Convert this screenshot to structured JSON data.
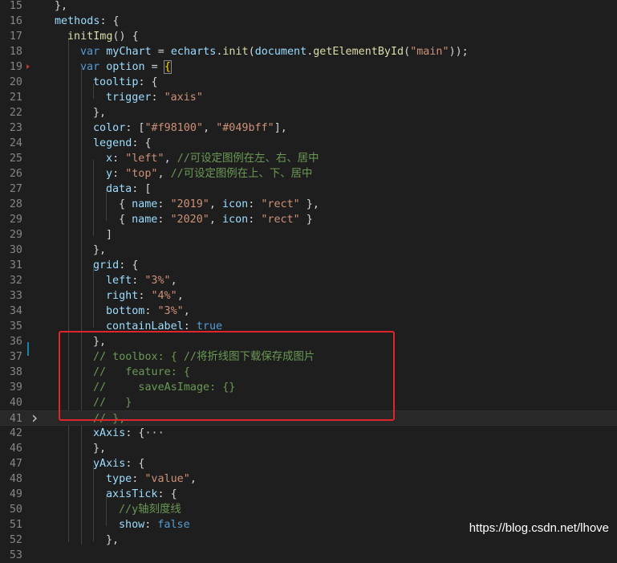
{
  "editor": {
    "lines": [
      {
        "n": "15",
        "tokens": [
          {
            "t": "},",
            "c": "p"
          }
        ]
      },
      {
        "n": "16",
        "tokens": [
          {
            "t": "methods",
            "c": "v"
          },
          {
            "t": ": {",
            "c": "p"
          }
        ]
      },
      {
        "n": "17",
        "tokens": [
          {
            "t": "initImg",
            "c": "f"
          },
          {
            "t": "() {",
            "c": "p"
          }
        ]
      },
      {
        "n": "18",
        "tokens": [
          {
            "t": "var ",
            "c": "k"
          },
          {
            "t": "myChart",
            "c": "v"
          },
          {
            "t": " = ",
            "c": "p"
          },
          {
            "t": "echarts",
            "c": "v"
          },
          {
            "t": ".",
            "c": "p"
          },
          {
            "t": "init",
            "c": "f"
          },
          {
            "t": "(",
            "c": "p"
          },
          {
            "t": "document",
            "c": "v"
          },
          {
            "t": ".",
            "c": "p"
          },
          {
            "t": "getElementById",
            "c": "f"
          },
          {
            "t": "(",
            "c": "p"
          },
          {
            "t": "\"main\"",
            "c": "s"
          },
          {
            "t": "));",
            "c": "p"
          }
        ]
      },
      {
        "n": "19",
        "tokens": [
          {
            "t": "var ",
            "c": "k"
          },
          {
            "t": "option",
            "c": "v"
          },
          {
            "t": " = ",
            "c": "p"
          },
          {
            "t": "{",
            "c": "bh"
          }
        ]
      },
      {
        "n": "20",
        "tokens": [
          {
            "t": "tooltip",
            "c": "v"
          },
          {
            "t": ": {",
            "c": "p"
          }
        ]
      },
      {
        "n": "21",
        "tokens": [
          {
            "t": "trigger",
            "c": "v"
          },
          {
            "t": ": ",
            "c": "p"
          },
          {
            "t": "\"axis\"",
            "c": "s"
          }
        ]
      },
      {
        "n": "22",
        "tokens": [
          {
            "t": "},",
            "c": "p"
          }
        ]
      },
      {
        "n": "23",
        "tokens": [
          {
            "t": "color",
            "c": "v"
          },
          {
            "t": ": [",
            "c": "p"
          },
          {
            "t": "\"#f98100\"",
            "c": "s"
          },
          {
            "t": ", ",
            "c": "p"
          },
          {
            "t": "\"#049bff\"",
            "c": "s"
          },
          {
            "t": "],",
            "c": "p"
          }
        ]
      },
      {
        "n": "24",
        "tokens": [
          {
            "t": "legend",
            "c": "v"
          },
          {
            "t": ": {",
            "c": "p"
          }
        ]
      },
      {
        "n": "25",
        "tokens": [
          {
            "t": "x",
            "c": "v"
          },
          {
            "t": ": ",
            "c": "p"
          },
          {
            "t": "\"left\"",
            "c": "s"
          },
          {
            "t": ", ",
            "c": "p"
          },
          {
            "t": "//可设定图例在左、右、居中",
            "c": "c"
          }
        ]
      },
      {
        "n": "26",
        "tokens": [
          {
            "t": "y",
            "c": "v"
          },
          {
            "t": ": ",
            "c": "p"
          },
          {
            "t": "\"top\"",
            "c": "s"
          },
          {
            "t": ", ",
            "c": "p"
          },
          {
            "t": "//可设定图例在上、下、居中",
            "c": "c"
          }
        ]
      },
      {
        "n": "27",
        "tokens": [
          {
            "t": "data",
            "c": "v"
          },
          {
            "t": ": [",
            "c": "p"
          }
        ]
      },
      {
        "n": "28",
        "tokens": [
          {
            "t": "{ ",
            "c": "p"
          },
          {
            "t": "name",
            "c": "v"
          },
          {
            "t": ": ",
            "c": "p"
          },
          {
            "t": "\"2019\"",
            "c": "s"
          },
          {
            "t": ", ",
            "c": "p"
          },
          {
            "t": "icon",
            "c": "v"
          },
          {
            "t": ": ",
            "c": "p"
          },
          {
            "t": "\"rect\"",
            "c": "s"
          },
          {
            "t": " },",
            "c": "p"
          }
        ]
      },
      {
        "n": "29",
        "tokens": [
          {
            "t": "{ ",
            "c": "p"
          },
          {
            "t": "name",
            "c": "v"
          },
          {
            "t": ": ",
            "c": "p"
          },
          {
            "t": "\"2020\"",
            "c": "s"
          },
          {
            "t": ", ",
            "c": "p"
          },
          {
            "t": "icon",
            "c": "v"
          },
          {
            "t": ": ",
            "c": "p"
          },
          {
            "t": "\"rect\"",
            "c": "s"
          },
          {
            "t": " }",
            "c": "p"
          }
        ]
      },
      {
        "n": "29",
        "tokens": [
          {
            "t": "]",
            "c": "p"
          }
        ]
      },
      {
        "n": "30",
        "tokens": [
          {
            "t": "},",
            "c": "p"
          }
        ]
      },
      {
        "n": "31",
        "tokens": [
          {
            "t": "grid",
            "c": "v"
          },
          {
            "t": ": {",
            "c": "p"
          }
        ]
      },
      {
        "n": "32",
        "tokens": [
          {
            "t": "left",
            "c": "v"
          },
          {
            "t": ": ",
            "c": "p"
          },
          {
            "t": "\"3%\"",
            "c": "s"
          },
          {
            "t": ",",
            "c": "p"
          }
        ]
      },
      {
        "n": "33",
        "tokens": [
          {
            "t": "right",
            "c": "v"
          },
          {
            "t": ": ",
            "c": "p"
          },
          {
            "t": "\"4%\"",
            "c": "s"
          },
          {
            "t": ",",
            "c": "p"
          }
        ]
      },
      {
        "n": "34",
        "tokens": [
          {
            "t": "bottom",
            "c": "v"
          },
          {
            "t": ": ",
            "c": "p"
          },
          {
            "t": "\"3%\"",
            "c": "s"
          },
          {
            "t": ",",
            "c": "p"
          }
        ]
      },
      {
        "n": "35",
        "tokens": [
          {
            "t": "containLabel",
            "c": "v"
          },
          {
            "t": ": ",
            "c": "p"
          },
          {
            "t": "true",
            "c": "k"
          }
        ]
      },
      {
        "n": "36",
        "tokens": [
          {
            "t": "},",
            "c": "p"
          }
        ]
      },
      {
        "n": "37",
        "tokens": [
          {
            "t": "// toolbox: { //将折线图下载保存成图片",
            "c": "c"
          }
        ]
      },
      {
        "n": "38",
        "tokens": [
          {
            "t": "//   feature: {",
            "c": "c"
          }
        ]
      },
      {
        "n": "39",
        "tokens": [
          {
            "t": "//     saveAsImage: {}",
            "c": "c"
          }
        ]
      },
      {
        "n": "40",
        "tokens": [
          {
            "t": "//   }",
            "c": "c"
          }
        ]
      },
      {
        "n": "41",
        "tokens": [
          {
            "t": "// },",
            "c": "c"
          }
        ]
      },
      {
        "n": "42",
        "tokens": [
          {
            "t": "xAxis",
            "c": "v"
          },
          {
            "t": ": {",
            "c": "p"
          },
          {
            "t": "···",
            "c": "e"
          }
        ]
      },
      {
        "n": "46",
        "tokens": [
          {
            "t": "},",
            "c": "p"
          }
        ]
      },
      {
        "n": "47",
        "tokens": [
          {
            "t": "yAxis",
            "c": "v"
          },
          {
            "t": ": {",
            "c": "p"
          }
        ]
      },
      {
        "n": "48",
        "tokens": [
          {
            "t": "type",
            "c": "v"
          },
          {
            "t": ": ",
            "c": "p"
          },
          {
            "t": "\"value\"",
            "c": "s"
          },
          {
            "t": ",",
            "c": "p"
          }
        ]
      },
      {
        "n": "49",
        "tokens": [
          {
            "t": "axisTick",
            "c": "v"
          },
          {
            "t": ": {",
            "c": "p"
          }
        ]
      },
      {
        "n": "50",
        "tokens": [
          {
            "t": "//y轴刻度线",
            "c": "c"
          }
        ]
      },
      {
        "n": "51",
        "tokens": [
          {
            "t": "show",
            "c": "v"
          },
          {
            "t": ": ",
            "c": "p"
          },
          {
            "t": "false",
            "c": "k"
          }
        ]
      },
      {
        "n": "52",
        "tokens": [
          {
            "t": "},",
            "c": "p"
          }
        ]
      },
      {
        "n": "53",
        "tokens": [
          {
            "t": "",
            "c": "p"
          }
        ]
      }
    ],
    "annotation_label": "highlight-box",
    "folded_icon": "chevron-right-icon"
  },
  "watermark": "https://blog.csdn.net/lhove",
  "colors": {
    "background": "#1e1e1e",
    "keyword": "#569cd6",
    "variable": "#9cdcfe",
    "function": "#dcdcaa",
    "string": "#ce9178",
    "comment": "#6a9955",
    "highlight_box": "#e0262c"
  }
}
